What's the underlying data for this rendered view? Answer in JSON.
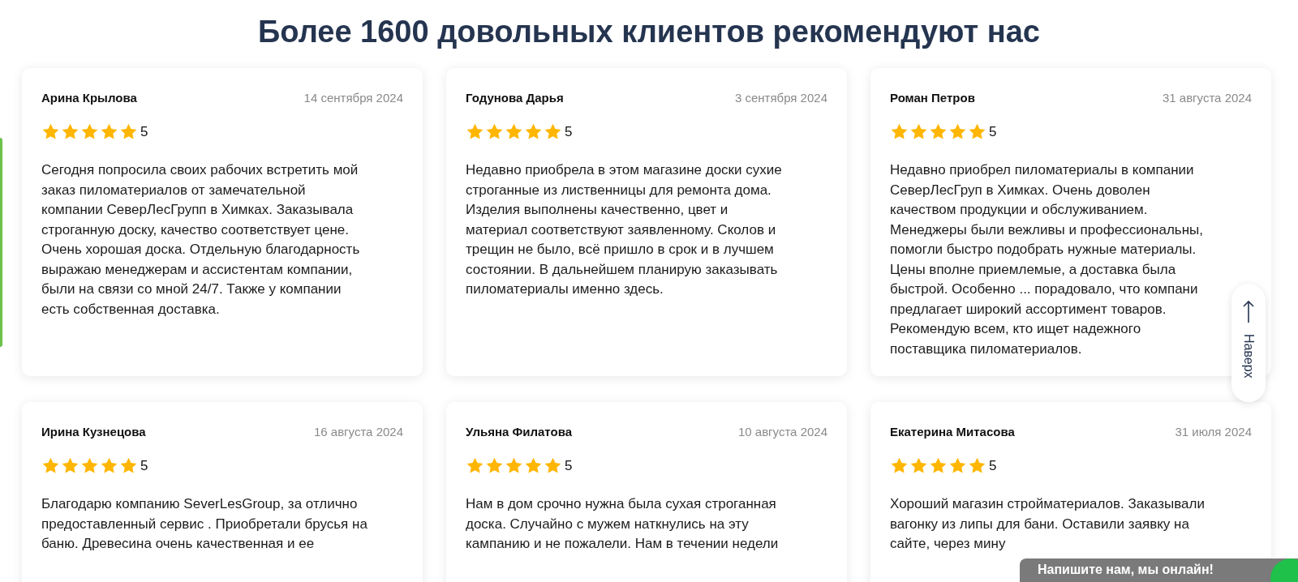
{
  "heading": "Более 1600 довольных клиентов рекомендуют нас",
  "reviews": [
    {
      "name": "Арина Крылова",
      "date": "14 сентября 2024",
      "stars": 5,
      "rating": "5",
      "text": "Сегодня попросила своих рабочих встретить мой\nзаказ пиломатериалов от замечательной\nкомпании СеверЛесГрупп в Химках. Заказывала\nстроганную доску, качество соответствует цене.\nОчень хорошая доска. Отдельную благодарность\nвыражаю менеджерам и ассистентам компании,\nбыли на связи со мной 24/7. Также у компании\nесть собственная доставка."
    },
    {
      "name": "Годунова Дарья",
      "date": "3 сентября 2024",
      "stars": 5,
      "rating": "5",
      "text": "Недавно приобрела в этом магазине доски сухие\nстроганные из лиственницы для ремонта дома.\nИзделия выполнены качественно, цвет и\nматериал соответствуют заявленному. Сколов и\nтрещин не было, всё пришло в срок и в лучшем\nсостоянии. В дальнейшем планирую заказывать\nпиломатериалы именно здесь."
    },
    {
      "name": "Роман Петров",
      "date": "31 августа 2024",
      "stars": 5,
      "rating": "5",
      "text": "Недавно приобрел пиломатериалы в компании\nСеверЛесГруп в Химках. Очень доволен\nкачеством продукции и обслуживанием.\nМенеджеры были вежливы и профессиональны,\nпомогли быстро подобрать нужные материалы.\nЦены вполне приемлемые, а доставка была\nбыстрой. Особенно ... порадовало, что компани\nпредлагает широкий ассортимент товаров.\nРекомендую всем, кто ищет надежного\nпоставщика пиломатериалов."
    },
    {
      "name": "Ирина Кузнецова",
      "date": "16 августа 2024",
      "stars": 5,
      "rating": "5",
      "text": "Благодарю компанию SeverLesGroup, за отлично\nпредоставленный сервис . Приобретали брусья на\nбаню. Древесина очень качественная и ее"
    },
    {
      "name": "Ульяна Филатова",
      "date": "10 августа 2024",
      "stars": 5,
      "rating": "5",
      "text": "Нам в дом срочно нужна была сухая строганная\nдоска. Случайно с мужем наткнулись на эту\nкампанию и не пожалели. Нам в течении недели"
    },
    {
      "name": "Екатерина Митасова",
      "date": "31 июля 2024",
      "stars": 5,
      "rating": "5",
      "text": "Хороший магазин стройматериалов. Заказывали\nвагонку из липы для бани. Оставили заявку на\nсайте, через мину"
    }
  ],
  "scroll_top": {
    "label": "Наверх"
  },
  "chat": {
    "label": "Напишите нам, мы онлайн!"
  }
}
